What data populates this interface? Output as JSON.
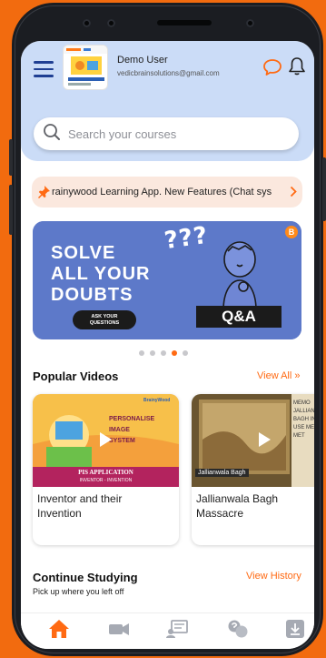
{
  "user": {
    "name": "Demo User",
    "email": "vedicbrainsolutions@gmail.com"
  },
  "search": {
    "placeholder": "Search your courses"
  },
  "announcement": {
    "text": "rainywood Learning App. New Features (Chat sys"
  },
  "banner": {
    "line1": "SOLVE",
    "line2": "ALL YOUR",
    "line3": "DOUBTS",
    "button": "ASK YOUR QUESTIONS",
    "button_line1": "ASK YOUR",
    "button_line2": "QUESTIONS",
    "qa": "Q&A",
    "question_marks": "???",
    "badge": "B"
  },
  "carousel": {
    "count": 5,
    "active_index": 3
  },
  "popular": {
    "title": "Popular Videos",
    "view_all": "View All »",
    "videos": [
      {
        "title": "Inventor and their Invention",
        "thumb_top": "BrainyWood",
        "thumb_lines": [
          "PERSONALISE",
          "IMAGE",
          "SYSTEM"
        ],
        "thumb_caption1": "PIS APPLICATION",
        "thumb_caption2": "INVENTOR - INVENTION"
      },
      {
        "title": "Jallianwala Bagh Massacre",
        "thumb_caption": "Jallianwala Bagh",
        "thumb_side_text": "MEMO JALLIAN BAGH INCIDE USE MEMOR MET"
      }
    ]
  },
  "continue": {
    "title": "Continue Studying",
    "view_history": "View History",
    "subtitle": "Pick up where you left off"
  },
  "nav": [
    {
      "icon": "home-icon",
      "active": true
    },
    {
      "icon": "video-camera-icon",
      "active": false
    },
    {
      "icon": "classroom-icon",
      "active": false
    },
    {
      "icon": "doubts-icon",
      "active": false
    },
    {
      "icon": "download-icon",
      "active": false
    }
  ],
  "colors": {
    "background": "#f26b0f",
    "accent": "#ff6a13",
    "header": "#cbdcf7",
    "menu": "#1f3f93",
    "banner": "#5d79c9"
  }
}
